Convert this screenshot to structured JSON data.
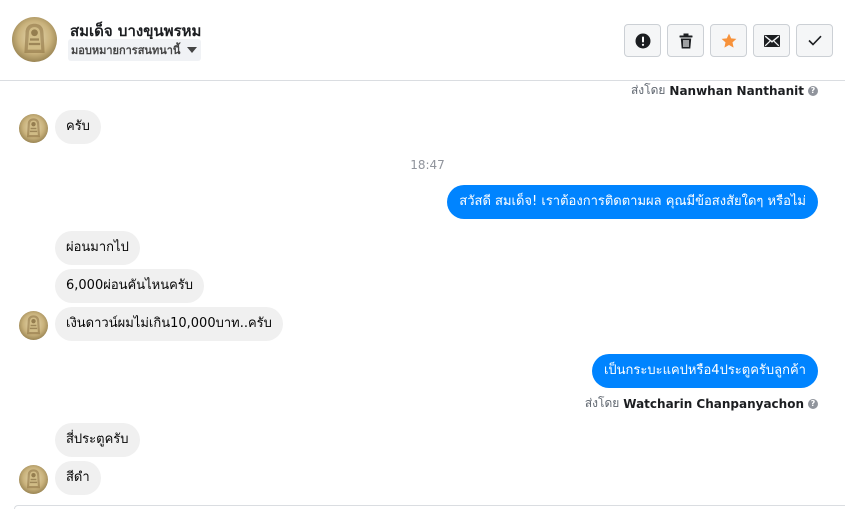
{
  "header": {
    "contact_name": "สมเด็จ บางขุนพรหม",
    "assign_label": "มอบหมายการสนทนานี้",
    "actions": [
      {
        "name": "spam-button",
        "icon": "exclamation-icon"
      },
      {
        "name": "delete-button",
        "icon": "trash-icon"
      },
      {
        "name": "star-button",
        "icon": "star-icon",
        "color": "#f7923b"
      },
      {
        "name": "mark-unread-button",
        "icon": "envelope-icon"
      },
      {
        "name": "mark-done-button",
        "icon": "checkmark-icon"
      }
    ]
  },
  "conversation": {
    "sent_by_1": {
      "prefix": "ส่งโดย",
      "name": "Nanwhan Nanthanit"
    },
    "msg_1": "ครับ",
    "time_1": "18:47",
    "msg_2": "สวัสดี สมเด็จ! เราต้องการติดตามผล คุณมีข้อสงสัยใดๆ หรือไม่",
    "msg_3": "ผ่อนมากไป",
    "msg_4": "6,000ผ่อนคันไหนครับ",
    "msg_5": "เงินดาวน์ผมไม่เกิน10,000บาท..ครับ",
    "msg_6": "เป็นกระบะแคปหรือ4ประตูครับลูกค้า",
    "sent_by_2": {
      "prefix": "ส่งโดย",
      "name": "Watcharin Chanpanyachon"
    },
    "msg_7": "สี่ประตูครับ",
    "msg_8": "สีดำ"
  },
  "colors": {
    "outgoing_bubble": "#0084ff",
    "incoming_bubble": "#f0f0f0",
    "star_accent": "#f7923b"
  }
}
